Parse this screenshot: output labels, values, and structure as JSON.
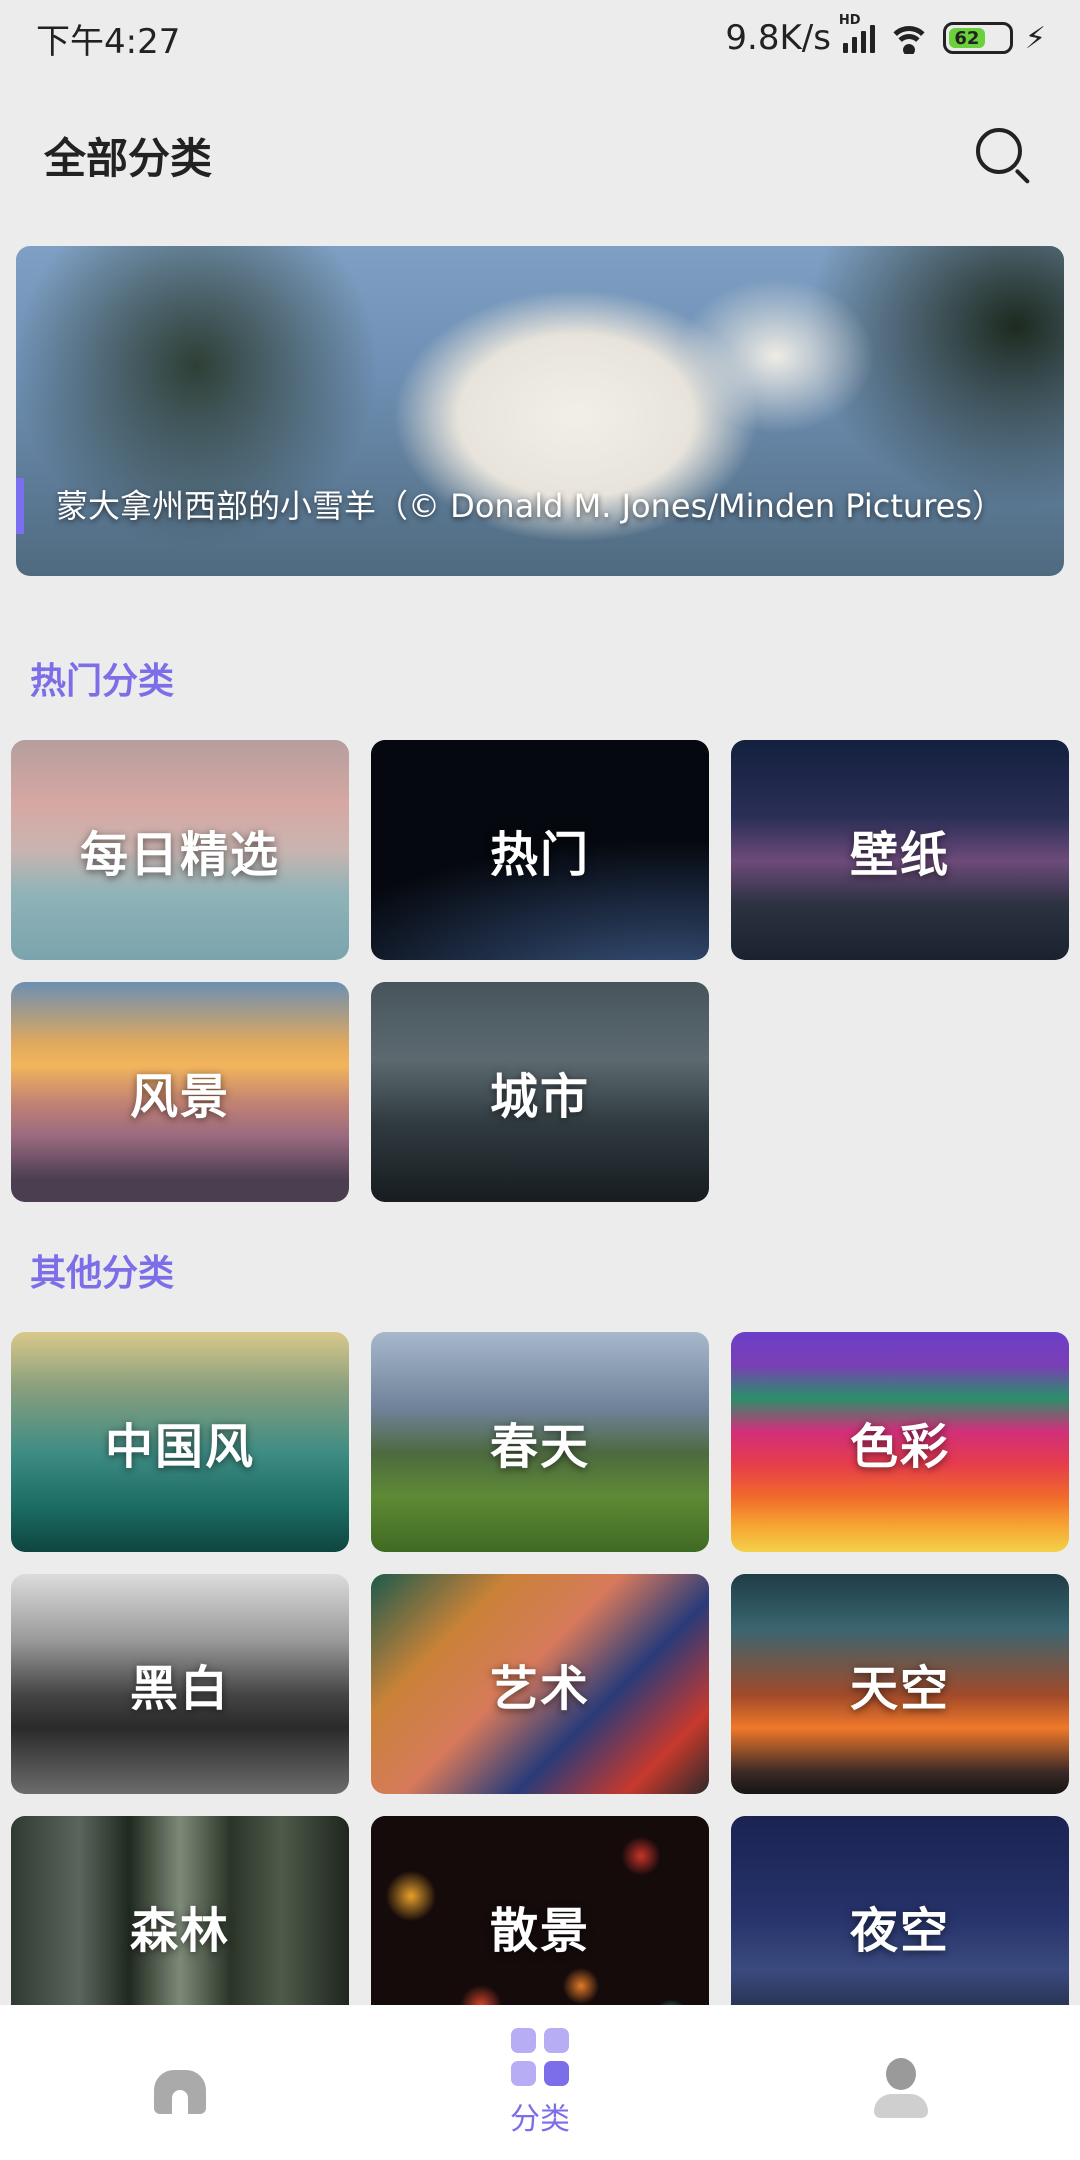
{
  "status_bar": {
    "time": "下午4:27",
    "network_speed": "9.8K/s",
    "network_type": "HD",
    "battery_level": "62",
    "icons": [
      "signal-icon",
      "wifi-icon",
      "battery-icon",
      "charging-icon"
    ]
  },
  "header": {
    "title": "全部分类",
    "search_icon": "search-icon"
  },
  "banner": {
    "caption": "蒙大拿州西部的小雪羊（© Donald M. Jones/Minden Pictures）"
  },
  "sections": {
    "hot": {
      "title": "热门分类",
      "items": [
        {
          "label": "每日精选"
        },
        {
          "label": "热门"
        },
        {
          "label": "壁纸"
        },
        {
          "label": "风景"
        },
        {
          "label": "城市"
        }
      ]
    },
    "other": {
      "title": "其他分类",
      "items": [
        {
          "label": "中国风"
        },
        {
          "label": "春天"
        },
        {
          "label": "色彩"
        },
        {
          "label": "黑白"
        },
        {
          "label": "艺术"
        },
        {
          "label": "天空"
        },
        {
          "label": "森林"
        },
        {
          "label": "散景"
        },
        {
          "label": "夜空"
        }
      ]
    }
  },
  "bottom_nav": {
    "items": [
      {
        "label": "",
        "icon": "home-icon",
        "active": false
      },
      {
        "label": "分类",
        "icon": "category-grid-icon",
        "active": true
      },
      {
        "label": "",
        "icon": "user-icon",
        "active": false
      }
    ]
  },
  "colors": {
    "accent": "#7c6ee8",
    "background": "#ececec",
    "nav_background": "#ffffff"
  }
}
